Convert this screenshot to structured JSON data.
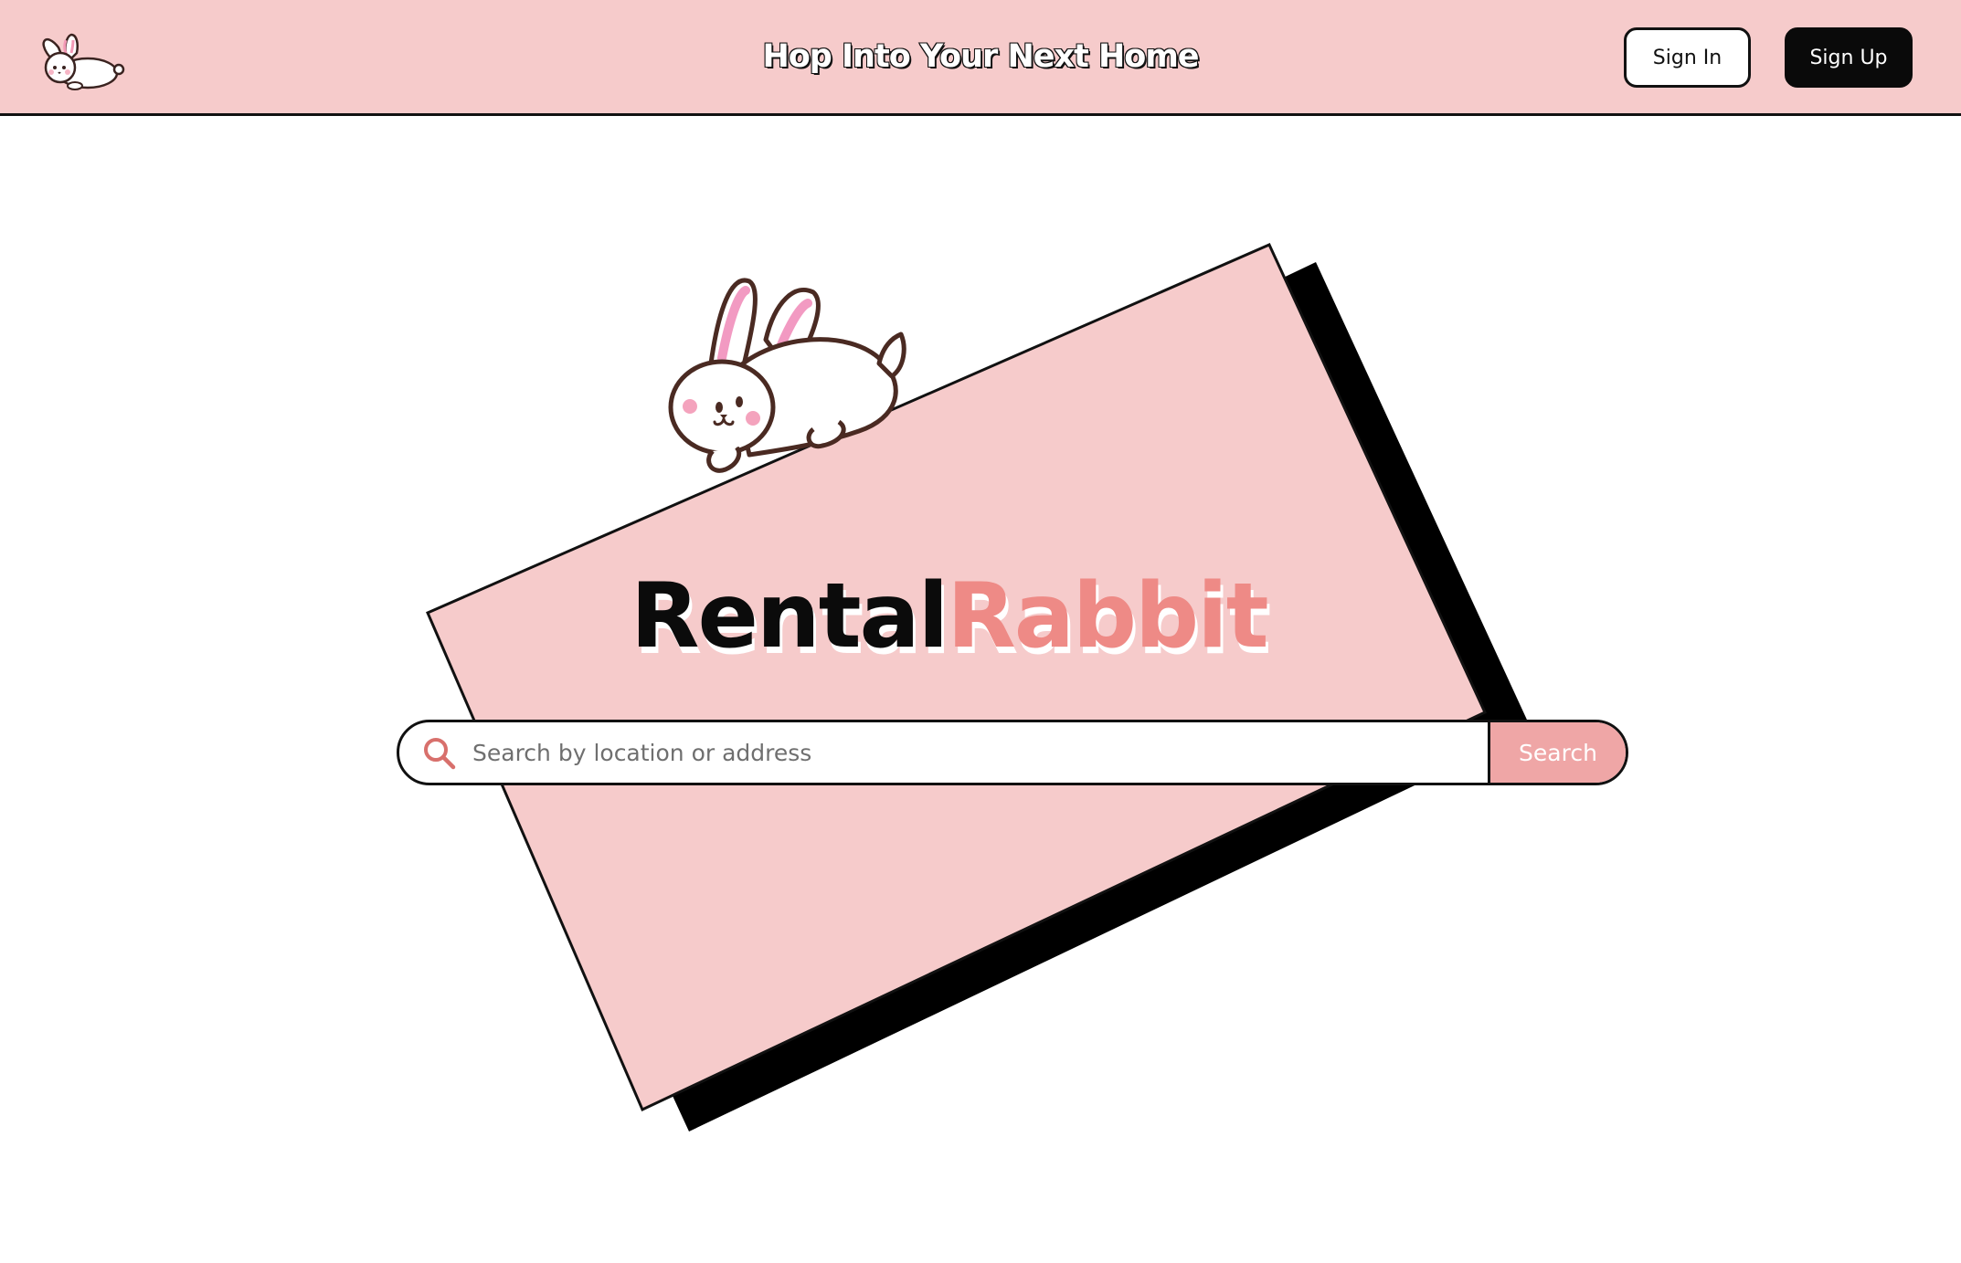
{
  "header": {
    "tagline": "Hop Into Your Next Home",
    "signin_label": "Sign In",
    "signup_label": "Sign Up"
  },
  "hero": {
    "brand_part1": "Rental",
    "brand_part2": "Rabbit"
  },
  "search": {
    "placeholder": "Search by location or address",
    "value": "",
    "button_label": "Search"
  },
  "colors": {
    "header_bg": "#f6cbcb",
    "card_pink": "#f6cbcb",
    "accent_salmon": "#ee8a86",
    "search_button": "#efa6a6",
    "dark": "#0a0a0a"
  },
  "icons": {
    "logo": "rabbit-icon",
    "search": "magnifier-icon",
    "mascot": "rabbit-mascot"
  }
}
